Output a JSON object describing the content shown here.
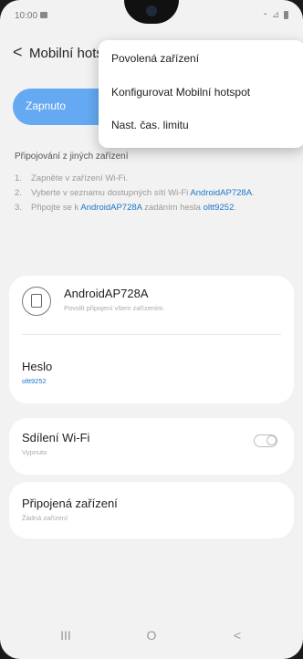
{
  "status": {
    "time": "10:00",
    "right_indicators": "⁃ ⊿ "
  },
  "header": {
    "back_glyph": "<",
    "title": "Mobilní hotspot"
  },
  "toggle": {
    "label": "Zapnuto"
  },
  "popup_menu": {
    "items": [
      {
        "label": "Povolená zařízení"
      },
      {
        "label": "Konfigurovat Mobilní hotspot"
      },
      {
        "label": "Nast. čas. limitu"
      }
    ]
  },
  "instructions": {
    "title": "Připojování z jiných zařízení",
    "steps": [
      {
        "num": "1.",
        "text": "Zapněte v zařízení Wi-Fi."
      },
      {
        "num": "2.",
        "text_a": "Vyberte v seznamu dostupných sítí Wi-Fi ",
        "highlight": "AndroidAP728A",
        "text_b": "."
      },
      {
        "num": "3.",
        "text_a": "Připojte se k ",
        "highlight": "AndroidAP728A",
        "text_b": " zadáním hesla ",
        "highlight2": "oltt9252",
        "text_c": "."
      }
    ]
  },
  "hotspot": {
    "icon": "hotspot-device-icon",
    "name": "AndroidAP728A",
    "subtitle": "Povolit připojení všem zařízením.",
    "password_label": "Heslo",
    "password_value": "oltt9252"
  },
  "wifi_sharing": {
    "label": "Sdílení Wi-Fi",
    "value": "Vypnuto",
    "enabled": false
  },
  "connected_devices": {
    "label": "Připojená zařízení",
    "value": "Žádná zařízení"
  },
  "navbar": {
    "recent": "III",
    "home": "O",
    "back": "<"
  },
  "colors": {
    "accent": "#64a9f2",
    "link": "#1e75c8"
  }
}
